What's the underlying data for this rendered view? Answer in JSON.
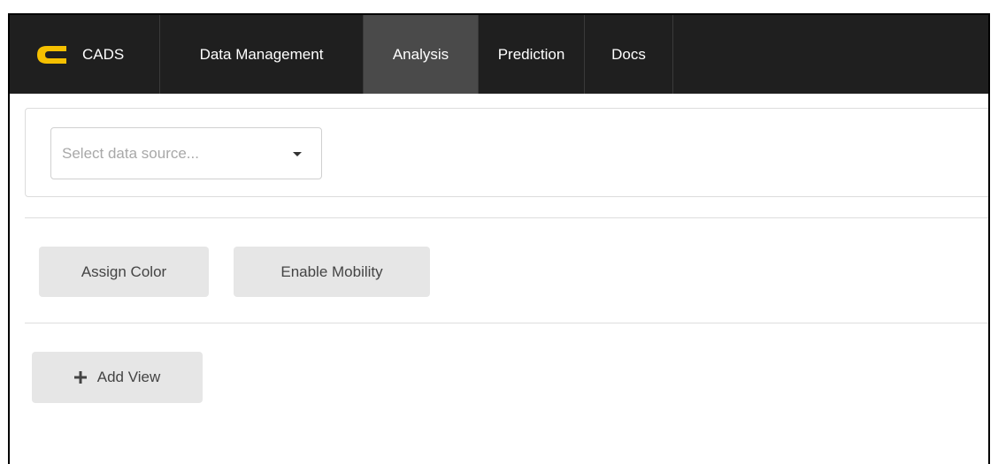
{
  "nav": {
    "brand": "CADS",
    "items": [
      {
        "label": "Data Management"
      },
      {
        "label": "Analysis",
        "active": true
      },
      {
        "label": "Prediction"
      },
      {
        "label": "Docs"
      }
    ]
  },
  "data_source": {
    "placeholder": "Select data source..."
  },
  "actions": {
    "assign_color": "Assign Color",
    "enable_mobility": "Enable Mobility",
    "add_view": "Add View"
  },
  "colors": {
    "navbar_bg": "#1f1f1f",
    "active_tab_bg": "#4a4a4a",
    "brand_logo": "#f5c000",
    "button_bg": "#e6e6e6"
  },
  "icons": {
    "brand": "cads-logo-icon",
    "dropdown": "caret-down-icon",
    "add": "plus-icon"
  }
}
